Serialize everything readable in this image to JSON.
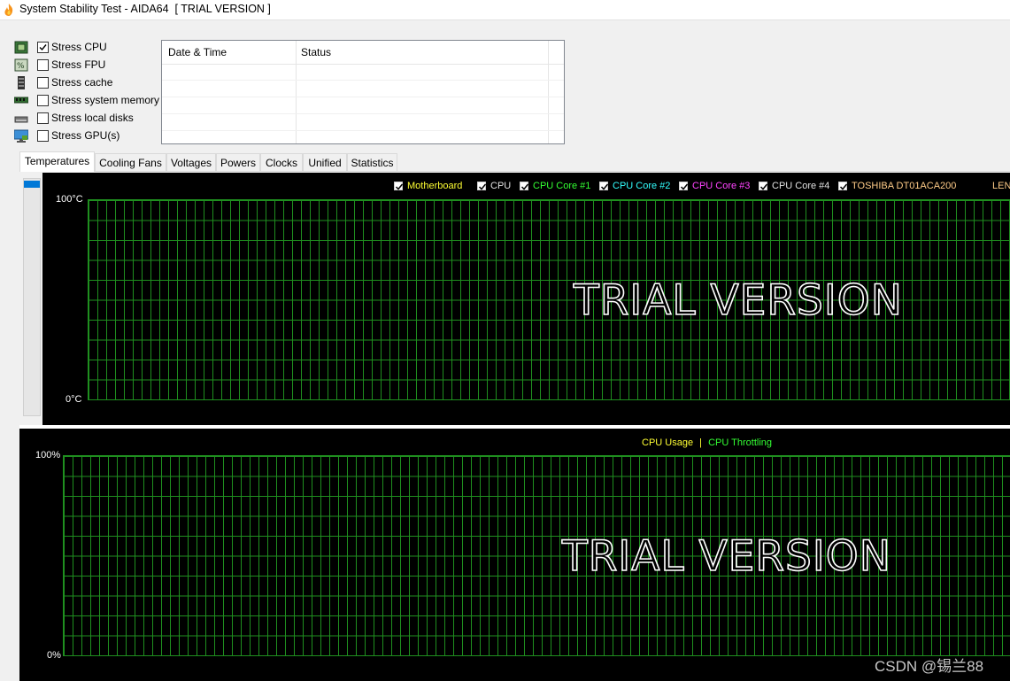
{
  "window": {
    "title": "System Stability Test - AIDA64  [ TRIAL VERSION ]"
  },
  "stress_options": [
    {
      "label": "Stress CPU",
      "checked": true,
      "icon": "cpu-chip-icon"
    },
    {
      "label": "Stress FPU",
      "checked": false,
      "icon": "fpu-icon"
    },
    {
      "label": "Stress cache",
      "checked": false,
      "icon": "cache-icon"
    },
    {
      "label": "Stress system memory",
      "checked": false,
      "icon": "memory-module-icon"
    },
    {
      "label": "Stress local disks",
      "checked": false,
      "icon": "disk-drive-icon"
    },
    {
      "label": "Stress GPU(s)",
      "checked": false,
      "icon": "monitor-gpu-icon"
    }
  ],
  "log_table": {
    "columns": [
      "Date & Time",
      "Status"
    ],
    "rows": []
  },
  "tabs": [
    {
      "label": "Temperatures",
      "active": true
    },
    {
      "label": "Cooling Fans",
      "active": false
    },
    {
      "label": "Voltages",
      "active": false
    },
    {
      "label": "Powers",
      "active": false
    },
    {
      "label": "Clocks",
      "active": false
    },
    {
      "label": "Unified",
      "active": false
    },
    {
      "label": "Statistics",
      "active": false
    }
  ],
  "temperature_chart": {
    "y_max_label": "100°C",
    "y_min_label": "0°C",
    "watermark": "TRIAL VERSION",
    "legend": [
      {
        "label": "Motherboard",
        "color": "#ffff33",
        "checked": true
      },
      {
        "label": "CPU",
        "color": "#e0e0e0",
        "checked": true
      },
      {
        "label": "CPU Core #1",
        "color": "#33ff33",
        "checked": true
      },
      {
        "label": "CPU Core #2",
        "color": "#33ffff",
        "checked": true
      },
      {
        "label": "CPU Core #3",
        "color": "#ff44ff",
        "checked": true
      },
      {
        "label": "CPU Core #4",
        "color": "#e0e0e0",
        "checked": true
      },
      {
        "label": "TOSHIBA DT01ACA200",
        "color": "#ffcc88",
        "checked": true
      },
      {
        "label": "LEN",
        "color": "#ffcc88",
        "checked": true
      }
    ]
  },
  "usage_chart": {
    "y_max_label": "100%",
    "y_min_label": "0%",
    "watermark": "TRIAL VERSION",
    "legend": [
      {
        "label": "CPU Usage",
        "color": "#ffff33"
      },
      {
        "label": "|",
        "color": "#ffff33"
      },
      {
        "label": "CPU Throttling",
        "color": "#33ff33"
      }
    ]
  },
  "image_watermark": "CSDN @锡兰88",
  "colors": {
    "graph_background": "#000000",
    "grid": "#1f8f1f",
    "accent_blue": "#0078d7"
  }
}
